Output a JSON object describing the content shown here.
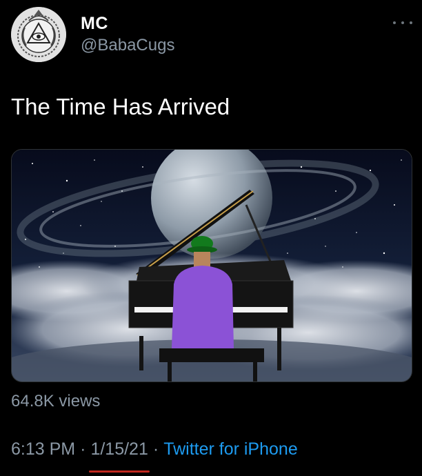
{
  "author": {
    "display_name": "MC",
    "handle": "@BabaCugs",
    "avatar_icon": "all-seeing-eye-emblem-icon"
  },
  "more_icon": "more-dots-icon",
  "tweet": {
    "text": "The Time Has Arrived",
    "views": "64.8K views",
    "time": "6:13 PM",
    "separator": "·",
    "date": "1/15/21",
    "source": "Twitter for iPhone"
  },
  "colors": {
    "background": "#000000",
    "primary_text": "#ffffff",
    "secondary_text": "#8b98a5",
    "link": "#1d9bf0",
    "date_underline": "#c0271e"
  }
}
